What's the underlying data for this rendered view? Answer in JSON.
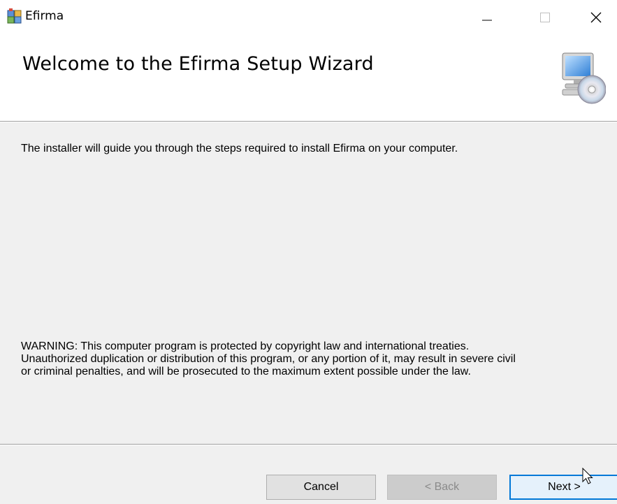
{
  "window": {
    "title": "Efirma",
    "icon": "installer-package-icon",
    "controls": {
      "minimize": "minimize-icon",
      "maximize": "maximize-icon",
      "close": "close-icon"
    }
  },
  "header": {
    "title": "Welcome to the Efirma Setup Wizard",
    "graphic": "computer-cd-icon"
  },
  "body": {
    "intro": "The installer will guide you through the steps required to install Efirma on your computer.",
    "warning_lines": [
      "WARNING: This computer program is protected by copyright law and international treaties.",
      "Unauthorized duplication or distribution of this program, or any portion of it, may result in severe civil",
      "or criminal penalties, and will be prosecuted to the maximum extent possible under the law."
    ]
  },
  "footer": {
    "cancel_label": "Cancel",
    "back_label": "< Back",
    "next_label": "Next >",
    "back_enabled": false
  },
  "colors": {
    "panel_bg": "#f0f0f0",
    "focus_border": "#0078d7",
    "disabled_text": "#8a8a8a"
  }
}
